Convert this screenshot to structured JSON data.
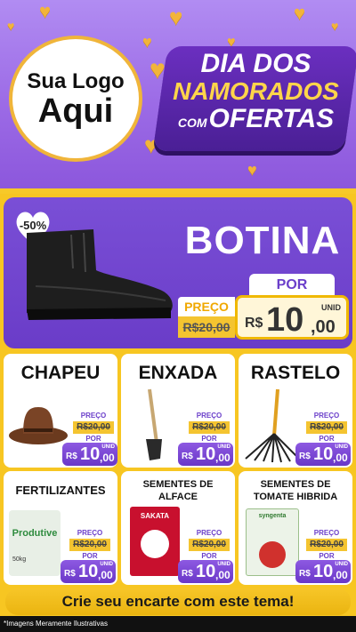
{
  "colors": {
    "purple": "#7a4fd6",
    "yellow": "#f7c622",
    "gold": "#f0b53a",
    "white": "#ffffff"
  },
  "header": {
    "logo_line1": "Sua Logo",
    "logo_line2": "Aqui",
    "title_line1": "DIA DOS",
    "title_line2": "NAMORADOS",
    "title_line3_prefix": "COM",
    "title_line3": "OFERTAS"
  },
  "featured": {
    "name": "BOTINA",
    "discount": "-50%",
    "preco_label": "PREÇO",
    "old_price": "R$20,00",
    "por_label": "POR",
    "currency": "R$",
    "price_int": "10",
    "price_dec": ",00",
    "unit": "UNID"
  },
  "products": [
    {
      "name": "CHAPEU",
      "preco_label": "PREÇO",
      "old_price": "R$20,00",
      "por_label": "POR",
      "currency": "R$",
      "price_int": "10",
      "price_dec": ",00",
      "unit": "UNID"
    },
    {
      "name": "ENXADA",
      "preco_label": "PREÇO",
      "old_price": "R$20,00",
      "por_label": "POR",
      "currency": "R$",
      "price_int": "10",
      "price_dec": ",00",
      "unit": "UNID"
    },
    {
      "name": "RASTELO",
      "preco_label": "PREÇO",
      "old_price": "R$20,00",
      "por_label": "POR",
      "currency": "R$",
      "price_int": "10",
      "price_dec": ",00",
      "unit": "UNID"
    },
    {
      "name": "FERTILIZANTES",
      "preco_label": "PREÇO",
      "old_price": "R$20,00",
      "por_label": "POR",
      "currency": "R$",
      "price_int": "10",
      "price_dec": ",00",
      "unit": "UNID",
      "package_label": "Produtive",
      "package_weight": "50kg"
    },
    {
      "name_line1": "SEMENTES DE",
      "name_line2": "ALFACE",
      "preco_label": "PREÇO",
      "old_price": "R$20,00",
      "por_label": "POR",
      "currency": "R$",
      "price_int": "10",
      "price_dec": ",00",
      "unit": "UNID",
      "package_label": "SAKATA"
    },
    {
      "name_line1": "SEMENTES DE",
      "name_line2": "TOMATE HIBRIDA",
      "preco_label": "PREÇO",
      "old_price": "R$20,00",
      "por_label": "POR",
      "currency": "R$",
      "price_int": "10",
      "price_dec": ",00",
      "unit": "UNID",
      "package_label": "syngenta"
    }
  ],
  "footer": {
    "cta": "Crie seu encarte com este tema!",
    "disclaimer": "*Imagens Meramente Ilustrativas"
  }
}
